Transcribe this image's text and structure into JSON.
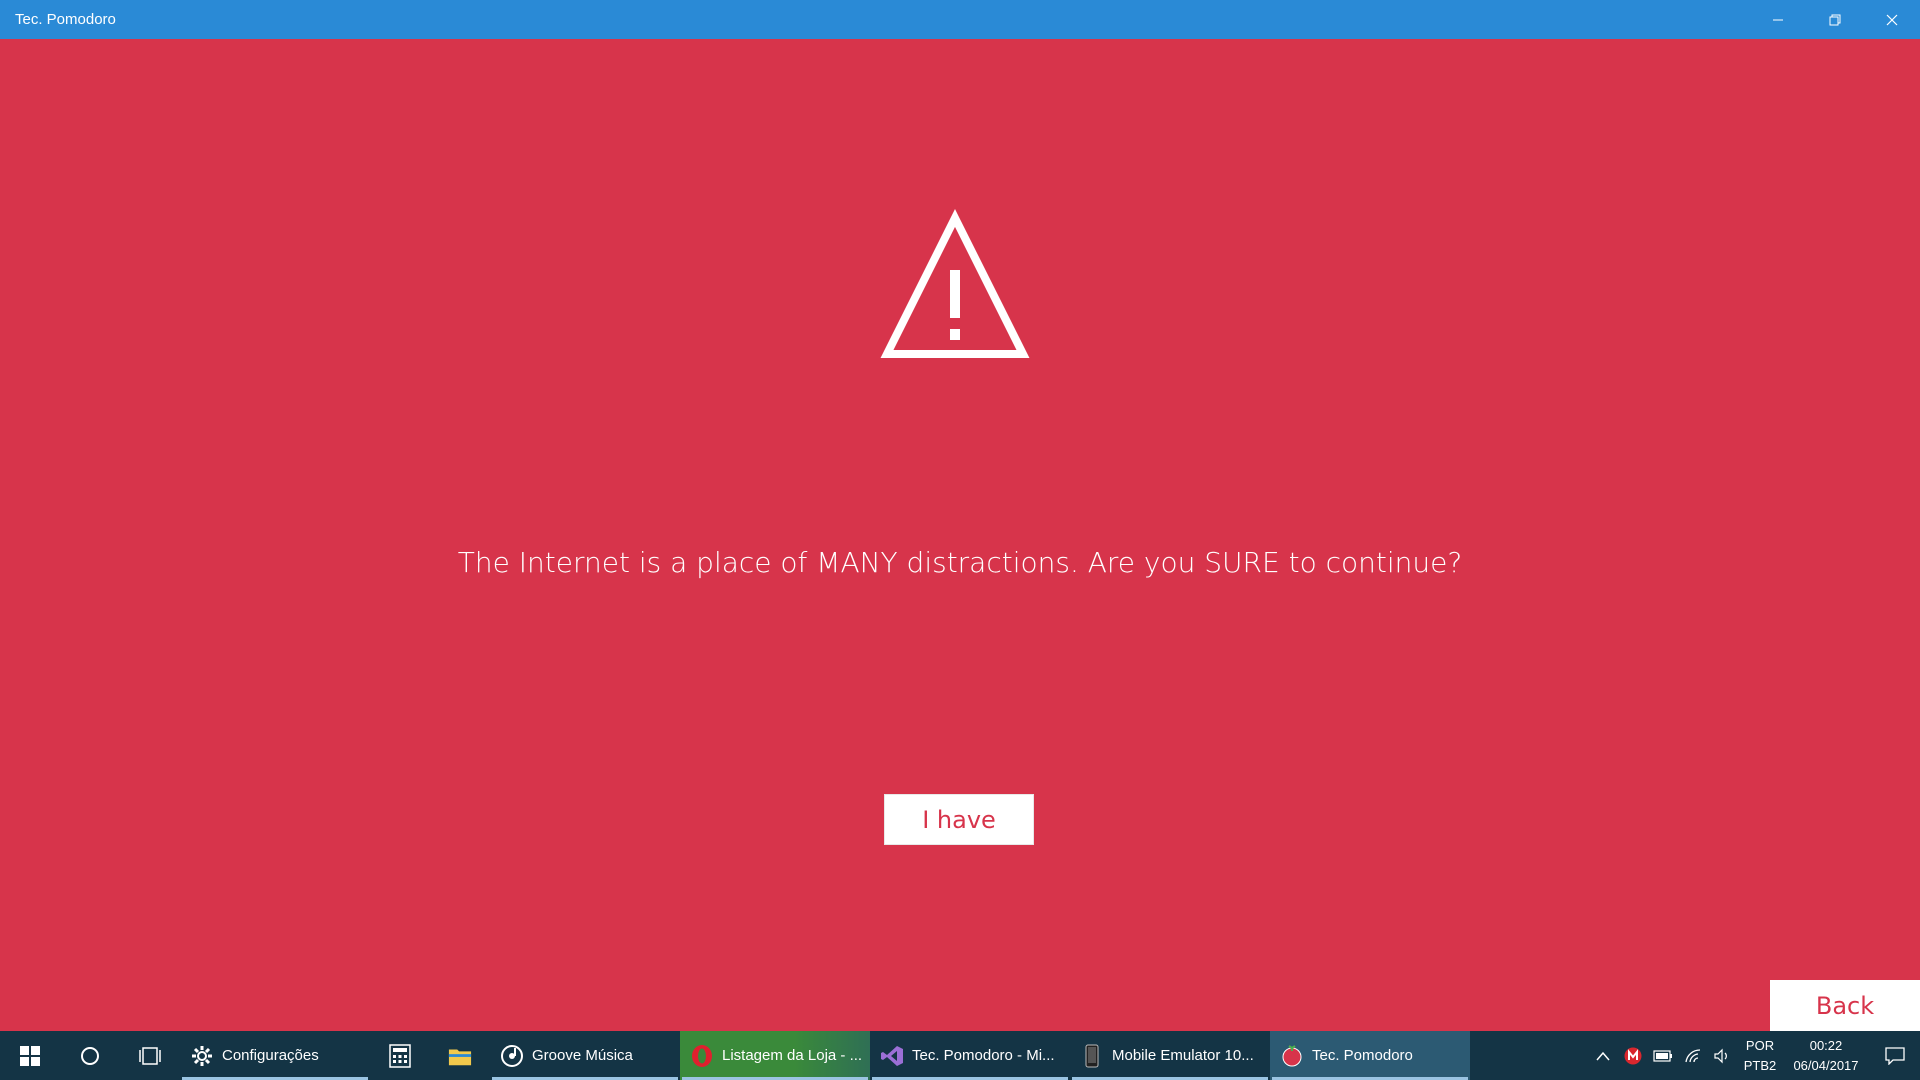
{
  "window": {
    "title": "Tec. Pomodoro",
    "controls": {
      "minimize_icon": "minimize-icon",
      "restore_icon": "restore-icon",
      "close_icon": "close-icon"
    }
  },
  "main": {
    "icon": "warning-triangle-icon",
    "message": "The Internet is a place of MANY distractions. Are you SURE to continue?",
    "confirm_label": "I have",
    "back_label": "Back"
  },
  "taskbar": {
    "apps": [
      {
        "label": "Configurações",
        "icon": "gear-icon"
      },
      {
        "label": "",
        "icon": "calculator-icon"
      },
      {
        "label": "",
        "icon": "folder-icon"
      },
      {
        "label": "Groove Música",
        "icon": "groove-icon"
      },
      {
        "label": "Listagem da Loja - ...",
        "icon": "opera-icon"
      },
      {
        "label": "Tec. Pomodoro - Mi...",
        "icon": "visual-studio-icon"
      },
      {
        "label": "Mobile Emulator 10...",
        "icon": "phone-icon"
      },
      {
        "label": "Tec. Pomodoro",
        "icon": "tomato-icon"
      }
    ],
    "language": {
      "line1": "POR",
      "line2": "PTB2"
    },
    "clock": {
      "time": "00:22",
      "date": "06/04/2017"
    }
  },
  "colors": {
    "background": "#d7344b",
    "titlebar": "#2a8ad6",
    "taskbar": "#143445",
    "button_text": "#d7344b"
  }
}
